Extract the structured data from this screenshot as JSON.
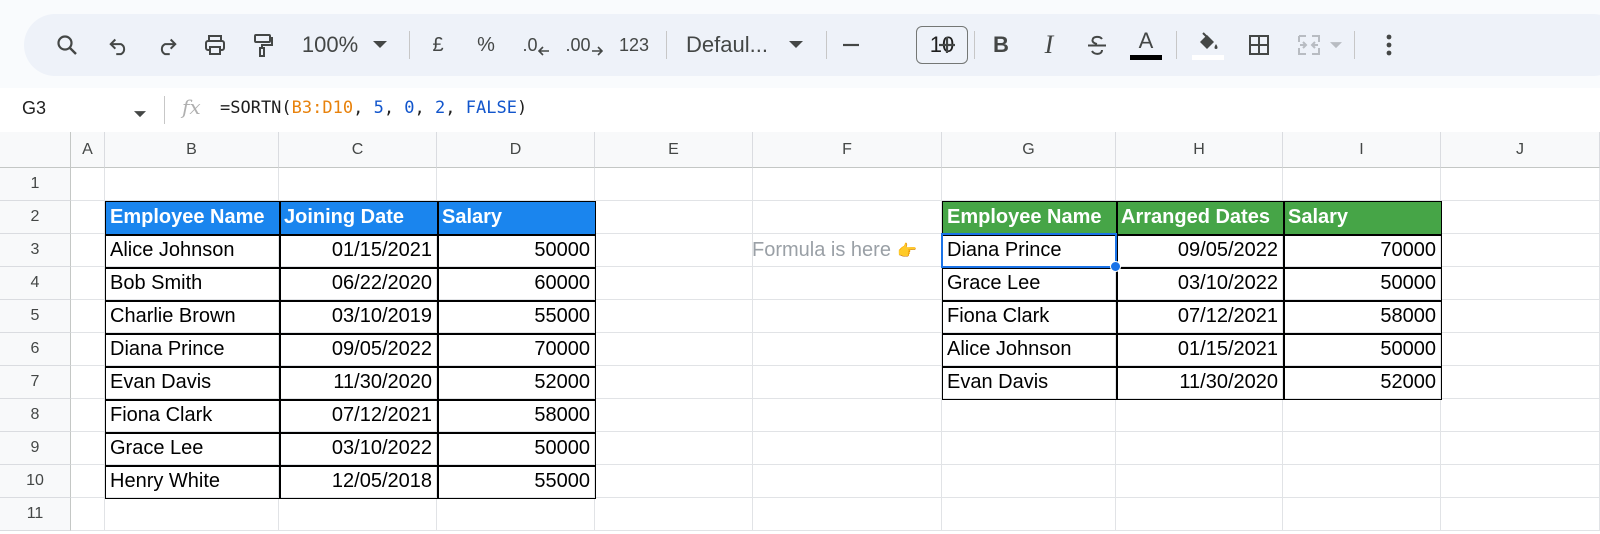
{
  "toolbar": {
    "zoom": "100%",
    "currency": "£",
    "percent": "%",
    "decrease_decimal": ".0",
    "increase_decimal": ".00",
    "number_format": "123",
    "font": "Defaul...",
    "font_size": "10",
    "bold": "B",
    "italic": "I",
    "text_color_glyph": "A"
  },
  "formula_bar": {
    "cell_ref": "G3",
    "formula_prefix": "=SORTN(",
    "formula_range": "B3:D10",
    "formula_sep1": ", ",
    "formula_arg1": "5",
    "formula_sep2": ", ",
    "formula_arg2": "0",
    "formula_sep3": ", ",
    "formula_arg3": "2",
    "formula_sep4": ", ",
    "formula_arg4": "FALSE",
    "formula_suffix": ")"
  },
  "columns": [
    "A",
    "B",
    "C",
    "D",
    "E",
    "F",
    "G",
    "H",
    "I",
    "J"
  ],
  "rows": [
    "1",
    "2",
    "3",
    "4",
    "5",
    "6",
    "7",
    "8",
    "9",
    "10",
    "11"
  ],
  "source_table": {
    "header_color": "#1a85ee",
    "headers": [
      "Employee Name",
      "Joining Date",
      "Salary"
    ],
    "rows": [
      [
        "Alice Johnson",
        "01/15/2021",
        "50000"
      ],
      [
        "Bob Smith",
        "06/22/2020",
        "60000"
      ],
      [
        "Charlie Brown",
        "03/10/2019",
        "55000"
      ],
      [
        "Diana Prince",
        "09/05/2022",
        "70000"
      ],
      [
        "Evan Davis",
        "11/30/2020",
        "52000"
      ],
      [
        "Fiona Clark",
        "07/12/2021",
        "58000"
      ],
      [
        "Grace Lee",
        "03/10/2022",
        "50000"
      ],
      [
        "Henry White",
        "12/05/2018",
        "55000"
      ]
    ]
  },
  "result_table": {
    "header_color": "#46a547",
    "headers": [
      "Employee Name",
      "Arranged Dates",
      "Salary"
    ],
    "rows": [
      [
        "Diana Prince",
        "09/05/2022",
        "70000"
      ],
      [
        "Grace Lee",
        "03/10/2022",
        "50000"
      ],
      [
        "Fiona Clark",
        "07/12/2021",
        "58000"
      ],
      [
        "Alice Johnson",
        "01/15/2021",
        "50000"
      ],
      [
        "Evan Davis",
        "11/30/2020",
        "52000"
      ]
    ]
  },
  "note": {
    "text": "Formula is here",
    "emoji": "👉"
  },
  "colors": {
    "selection": "#1a73e8",
    "toolbar_bg": "#eef2f9"
  }
}
